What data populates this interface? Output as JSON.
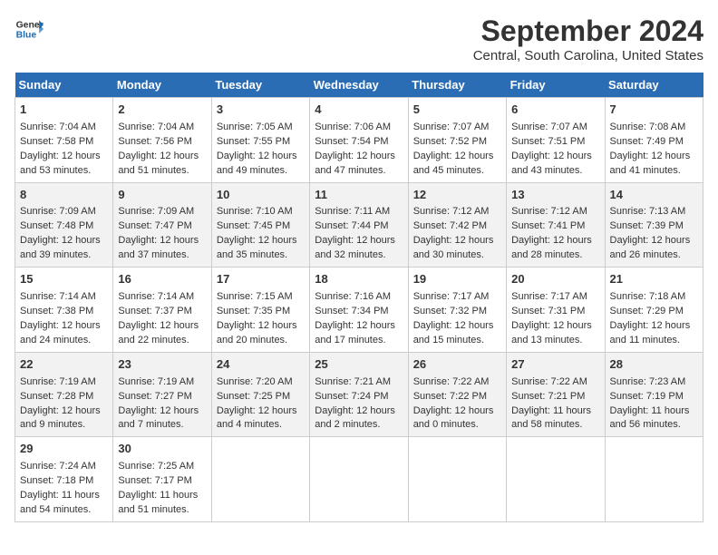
{
  "title": "September 2024",
  "subtitle": "Central, South Carolina, United States",
  "logo": {
    "line1": "General",
    "line2": "Blue"
  },
  "days_of_week": [
    "Sunday",
    "Monday",
    "Tuesday",
    "Wednesday",
    "Thursday",
    "Friday",
    "Saturday"
  ],
  "weeks": [
    [
      {
        "day": "1",
        "lines": [
          "Sunrise: 7:04 AM",
          "Sunset: 7:58 PM",
          "Daylight: 12 hours",
          "and 53 minutes."
        ]
      },
      {
        "day": "2",
        "lines": [
          "Sunrise: 7:04 AM",
          "Sunset: 7:56 PM",
          "Daylight: 12 hours",
          "and 51 minutes."
        ]
      },
      {
        "day": "3",
        "lines": [
          "Sunrise: 7:05 AM",
          "Sunset: 7:55 PM",
          "Daylight: 12 hours",
          "and 49 minutes."
        ]
      },
      {
        "day": "4",
        "lines": [
          "Sunrise: 7:06 AM",
          "Sunset: 7:54 PM",
          "Daylight: 12 hours",
          "and 47 minutes."
        ]
      },
      {
        "day": "5",
        "lines": [
          "Sunrise: 7:07 AM",
          "Sunset: 7:52 PM",
          "Daylight: 12 hours",
          "and 45 minutes."
        ]
      },
      {
        "day": "6",
        "lines": [
          "Sunrise: 7:07 AM",
          "Sunset: 7:51 PM",
          "Daylight: 12 hours",
          "and 43 minutes."
        ]
      },
      {
        "day": "7",
        "lines": [
          "Sunrise: 7:08 AM",
          "Sunset: 7:49 PM",
          "Daylight: 12 hours",
          "and 41 minutes."
        ]
      }
    ],
    [
      {
        "day": "8",
        "lines": [
          "Sunrise: 7:09 AM",
          "Sunset: 7:48 PM",
          "Daylight: 12 hours",
          "and 39 minutes."
        ]
      },
      {
        "day": "9",
        "lines": [
          "Sunrise: 7:09 AM",
          "Sunset: 7:47 PM",
          "Daylight: 12 hours",
          "and 37 minutes."
        ]
      },
      {
        "day": "10",
        "lines": [
          "Sunrise: 7:10 AM",
          "Sunset: 7:45 PM",
          "Daylight: 12 hours",
          "and 35 minutes."
        ]
      },
      {
        "day": "11",
        "lines": [
          "Sunrise: 7:11 AM",
          "Sunset: 7:44 PM",
          "Daylight: 12 hours",
          "and 32 minutes."
        ]
      },
      {
        "day": "12",
        "lines": [
          "Sunrise: 7:12 AM",
          "Sunset: 7:42 PM",
          "Daylight: 12 hours",
          "and 30 minutes."
        ]
      },
      {
        "day": "13",
        "lines": [
          "Sunrise: 7:12 AM",
          "Sunset: 7:41 PM",
          "Daylight: 12 hours",
          "and 28 minutes."
        ]
      },
      {
        "day": "14",
        "lines": [
          "Sunrise: 7:13 AM",
          "Sunset: 7:39 PM",
          "Daylight: 12 hours",
          "and 26 minutes."
        ]
      }
    ],
    [
      {
        "day": "15",
        "lines": [
          "Sunrise: 7:14 AM",
          "Sunset: 7:38 PM",
          "Daylight: 12 hours",
          "and 24 minutes."
        ]
      },
      {
        "day": "16",
        "lines": [
          "Sunrise: 7:14 AM",
          "Sunset: 7:37 PM",
          "Daylight: 12 hours",
          "and 22 minutes."
        ]
      },
      {
        "day": "17",
        "lines": [
          "Sunrise: 7:15 AM",
          "Sunset: 7:35 PM",
          "Daylight: 12 hours",
          "and 20 minutes."
        ]
      },
      {
        "day": "18",
        "lines": [
          "Sunrise: 7:16 AM",
          "Sunset: 7:34 PM",
          "Daylight: 12 hours",
          "and 17 minutes."
        ]
      },
      {
        "day": "19",
        "lines": [
          "Sunrise: 7:17 AM",
          "Sunset: 7:32 PM",
          "Daylight: 12 hours",
          "and 15 minutes."
        ]
      },
      {
        "day": "20",
        "lines": [
          "Sunrise: 7:17 AM",
          "Sunset: 7:31 PM",
          "Daylight: 12 hours",
          "and 13 minutes."
        ]
      },
      {
        "day": "21",
        "lines": [
          "Sunrise: 7:18 AM",
          "Sunset: 7:29 PM",
          "Daylight: 12 hours",
          "and 11 minutes."
        ]
      }
    ],
    [
      {
        "day": "22",
        "lines": [
          "Sunrise: 7:19 AM",
          "Sunset: 7:28 PM",
          "Daylight: 12 hours",
          "and 9 minutes."
        ]
      },
      {
        "day": "23",
        "lines": [
          "Sunrise: 7:19 AM",
          "Sunset: 7:27 PM",
          "Daylight: 12 hours",
          "and 7 minutes."
        ]
      },
      {
        "day": "24",
        "lines": [
          "Sunrise: 7:20 AM",
          "Sunset: 7:25 PM",
          "Daylight: 12 hours",
          "and 4 minutes."
        ]
      },
      {
        "day": "25",
        "lines": [
          "Sunrise: 7:21 AM",
          "Sunset: 7:24 PM",
          "Daylight: 12 hours",
          "and 2 minutes."
        ]
      },
      {
        "day": "26",
        "lines": [
          "Sunrise: 7:22 AM",
          "Sunset: 7:22 PM",
          "Daylight: 12 hours",
          "and 0 minutes."
        ]
      },
      {
        "day": "27",
        "lines": [
          "Sunrise: 7:22 AM",
          "Sunset: 7:21 PM",
          "Daylight: 11 hours",
          "and 58 minutes."
        ]
      },
      {
        "day": "28",
        "lines": [
          "Sunrise: 7:23 AM",
          "Sunset: 7:19 PM",
          "Daylight: 11 hours",
          "and 56 minutes."
        ]
      }
    ],
    [
      {
        "day": "29",
        "lines": [
          "Sunrise: 7:24 AM",
          "Sunset: 7:18 PM",
          "Daylight: 11 hours",
          "and 54 minutes."
        ]
      },
      {
        "day": "30",
        "lines": [
          "Sunrise: 7:25 AM",
          "Sunset: 7:17 PM",
          "Daylight: 11 hours",
          "and 51 minutes."
        ]
      },
      null,
      null,
      null,
      null,
      null
    ]
  ]
}
